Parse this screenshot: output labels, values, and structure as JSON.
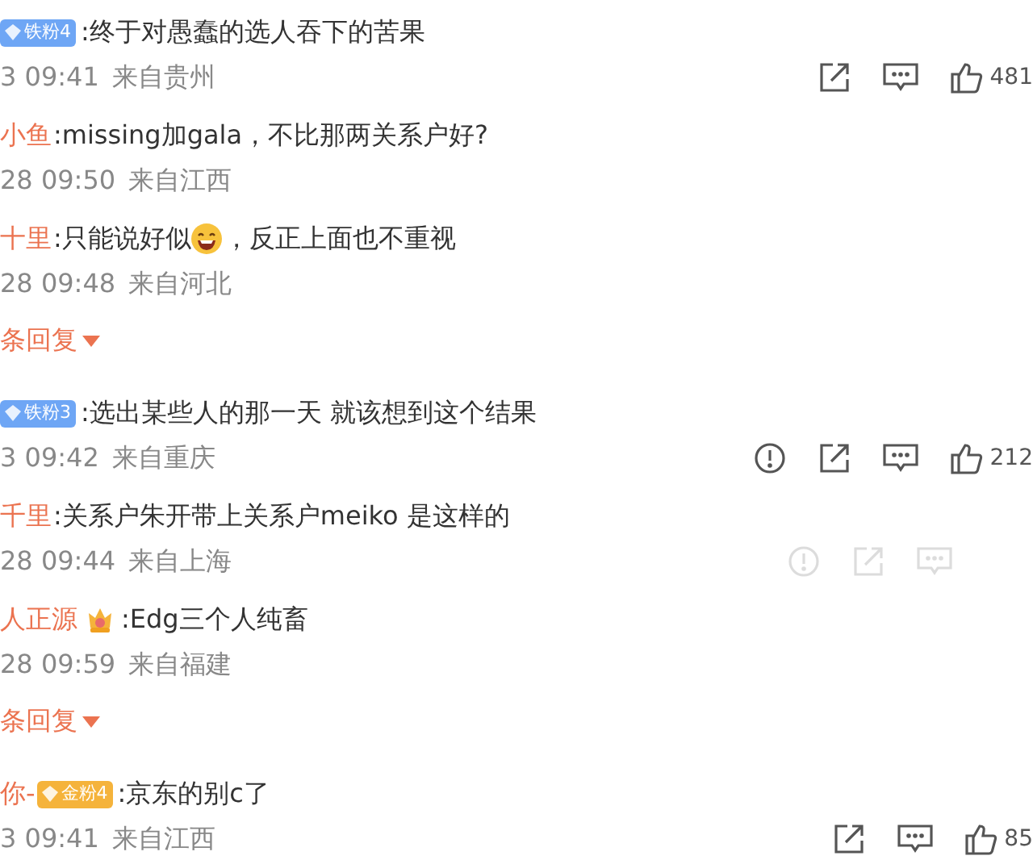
{
  "items": [
    {
      "kind": "comment",
      "badge": {
        "kind": "fan",
        "label": "铁粉4",
        "color": "#6ea6f5"
      },
      "text": [
        {
          "kind": "text",
          "text": ":终于对愚蠢的选人吞下的苦果"
        }
      ],
      "time": "3 09:41",
      "location": "来自贵州",
      "actions": [
        {
          "kind": "share"
        },
        {
          "kind": "comment"
        },
        {
          "kind": "like"
        }
      ],
      "likes": "481",
      "faded": false
    },
    {
      "kind": "reply",
      "name": "小鱼",
      "text": [
        {
          "kind": "text",
          "text": ":missing加gala，不比那两关系户好?"
        }
      ],
      "time": "28 09:50",
      "location": "来自江西"
    },
    {
      "kind": "reply",
      "name": "十里",
      "text": [
        {
          "kind": "text",
          "text": ":只能说好似"
        },
        {
          "kind": "emoji"
        },
        {
          "kind": "text",
          "text": "，反正上面也不重视"
        }
      ],
      "time": "28 09:48",
      "location": "来自河北"
    },
    {
      "kind": "more",
      "label": "条回复"
    },
    {
      "kind": "comment",
      "badge": {
        "kind": "fan",
        "label": "铁粉3",
        "color": "#6ea6f5"
      },
      "text": [
        {
          "kind": "text",
          "text": ":选出某些人的那一天 就该想到这个结果"
        }
      ],
      "time": "3 09:42",
      "location": "来自重庆",
      "actions": [
        {
          "kind": "report"
        },
        {
          "kind": "share"
        },
        {
          "kind": "comment"
        },
        {
          "kind": "like"
        }
      ],
      "likes": "212",
      "faded": false
    },
    {
      "kind": "reply",
      "name": "千里",
      "text": [
        {
          "kind": "text",
          "text": ":关系户朱开带上关系户meiko 是这样的"
        }
      ],
      "time": "28 09:44",
      "location": "来自上海",
      "actions": [
        {
          "kind": "report"
        },
        {
          "kind": "share"
        },
        {
          "kind": "comment"
        }
      ],
      "faded": true
    },
    {
      "kind": "reply",
      "name": "人正源",
      "badge": {
        "kind": "crown"
      },
      "text": [
        {
          "kind": "text",
          "text": ":Edg三个人纯畜"
        }
      ],
      "time": "28 09:59",
      "location": "来自福建"
    },
    {
      "kind": "more",
      "label": "条回复"
    },
    {
      "kind": "comment",
      "name": "你-",
      "badge": {
        "kind": "fan",
        "label": "金粉4",
        "color": "#f5b33b"
      },
      "text": [
        {
          "kind": "text",
          "text": ":京东的别c了"
        }
      ],
      "time": "3 09:41",
      "location": "来自江西",
      "actions": [
        {
          "kind": "share"
        },
        {
          "kind": "comment"
        },
        {
          "kind": "like"
        }
      ],
      "likes": "85",
      "faded": false
    }
  ]
}
